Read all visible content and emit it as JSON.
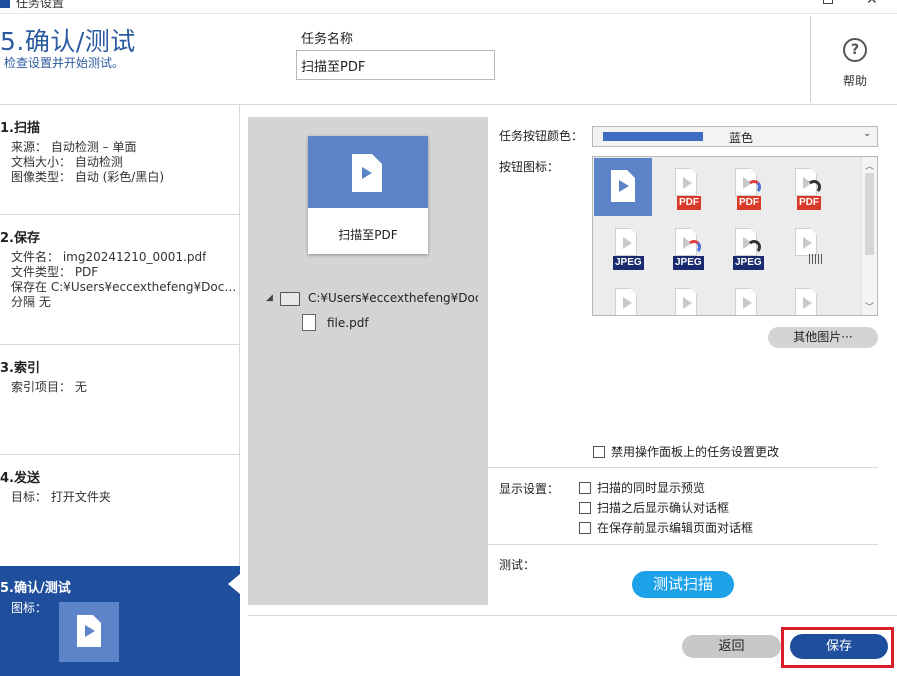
{
  "window": {
    "title": "任务设置"
  },
  "header": {
    "step_title": "5.确认/测试",
    "step_subtitle": "检查设置并开始测试。",
    "task_name_label": "任务名称",
    "task_name_value": "扫描至PDF",
    "help_label": "帮助"
  },
  "sidebar": {
    "scan": {
      "title": "1.扫描",
      "lines": [
        "来源：  自动检测  – 单面",
        "文档大小：  自动检测",
        "图像类型：  自动 (彩色/黑白)"
      ]
    },
    "save": {
      "title": "2.保存",
      "lines": [
        "文件名：  img20241210_0001.pdf",
        "文件类型：  PDF",
        "保存在  C:¥Users¥eccexthefeng¥Documents",
        "分隔  无"
      ]
    },
    "index": {
      "title": "3.索引",
      "lines": [
        "索引项目：  无"
      ]
    },
    "send": {
      "title": "4.发送",
      "lines": [
        "目标：  打开文件夹"
      ]
    },
    "confirm": {
      "title": "5.确认/测试",
      "icon_label": "图标："
    }
  },
  "preview": {
    "card_label": "扫描至PDF",
    "folder_path": "C:¥Users¥eccexthefeng¥Documents",
    "file_name": "file.pdf"
  },
  "settings": {
    "color_label": "任务按钮颜色：",
    "color_value": "蓝色",
    "color_hex": "#3d6cc0",
    "icons_label": "按钮图标：",
    "icon_badges": [
      "",
      "PDF",
      "PDF",
      "PDF",
      "JPEG",
      "JPEG",
      "JPEG",
      "",
      "",
      "",
      "",
      ""
    ],
    "more_images": "其他图片···",
    "disable_change": "禁用操作面板上的任务设置更改",
    "display_label": "显示设置：",
    "display_options": [
      "扫描的同时显示预览",
      "扫描之后显示确认对话框",
      "在保存前显示编辑页面对话框"
    ],
    "test_label": "测试：",
    "test_button": "测试扫描"
  },
  "footer": {
    "back_button": "返回",
    "save_button": "保存"
  },
  "colors": {
    "accent": "#1f4e9c",
    "icon_blue": "#5d84c8",
    "test_button": "#1da1e8",
    "highlight": "#d8202a"
  }
}
